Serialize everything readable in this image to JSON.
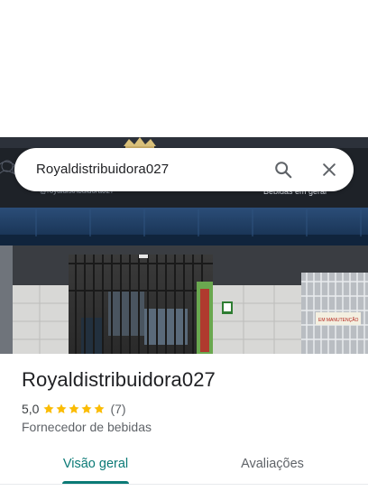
{
  "search": {
    "query": "Royaldistribuidora027"
  },
  "photo": {
    "sign_handle": "@royaldistribuidora027",
    "sign_text": "Bebidas em geral",
    "notice_text": "EM MANUTENÇÃO"
  },
  "place": {
    "name": "Royaldistribuidora027",
    "rating": "5,0",
    "review_count": "(7)",
    "stars": 5,
    "category": "Fornecedor de bebidas"
  },
  "tabs": [
    {
      "label": "Visão geral",
      "active": true
    },
    {
      "label": "Avaliações",
      "active": false
    }
  ],
  "colors": {
    "accent": "#0b7a76",
    "star": "#fbbc04",
    "awning": "#1f3f66"
  }
}
